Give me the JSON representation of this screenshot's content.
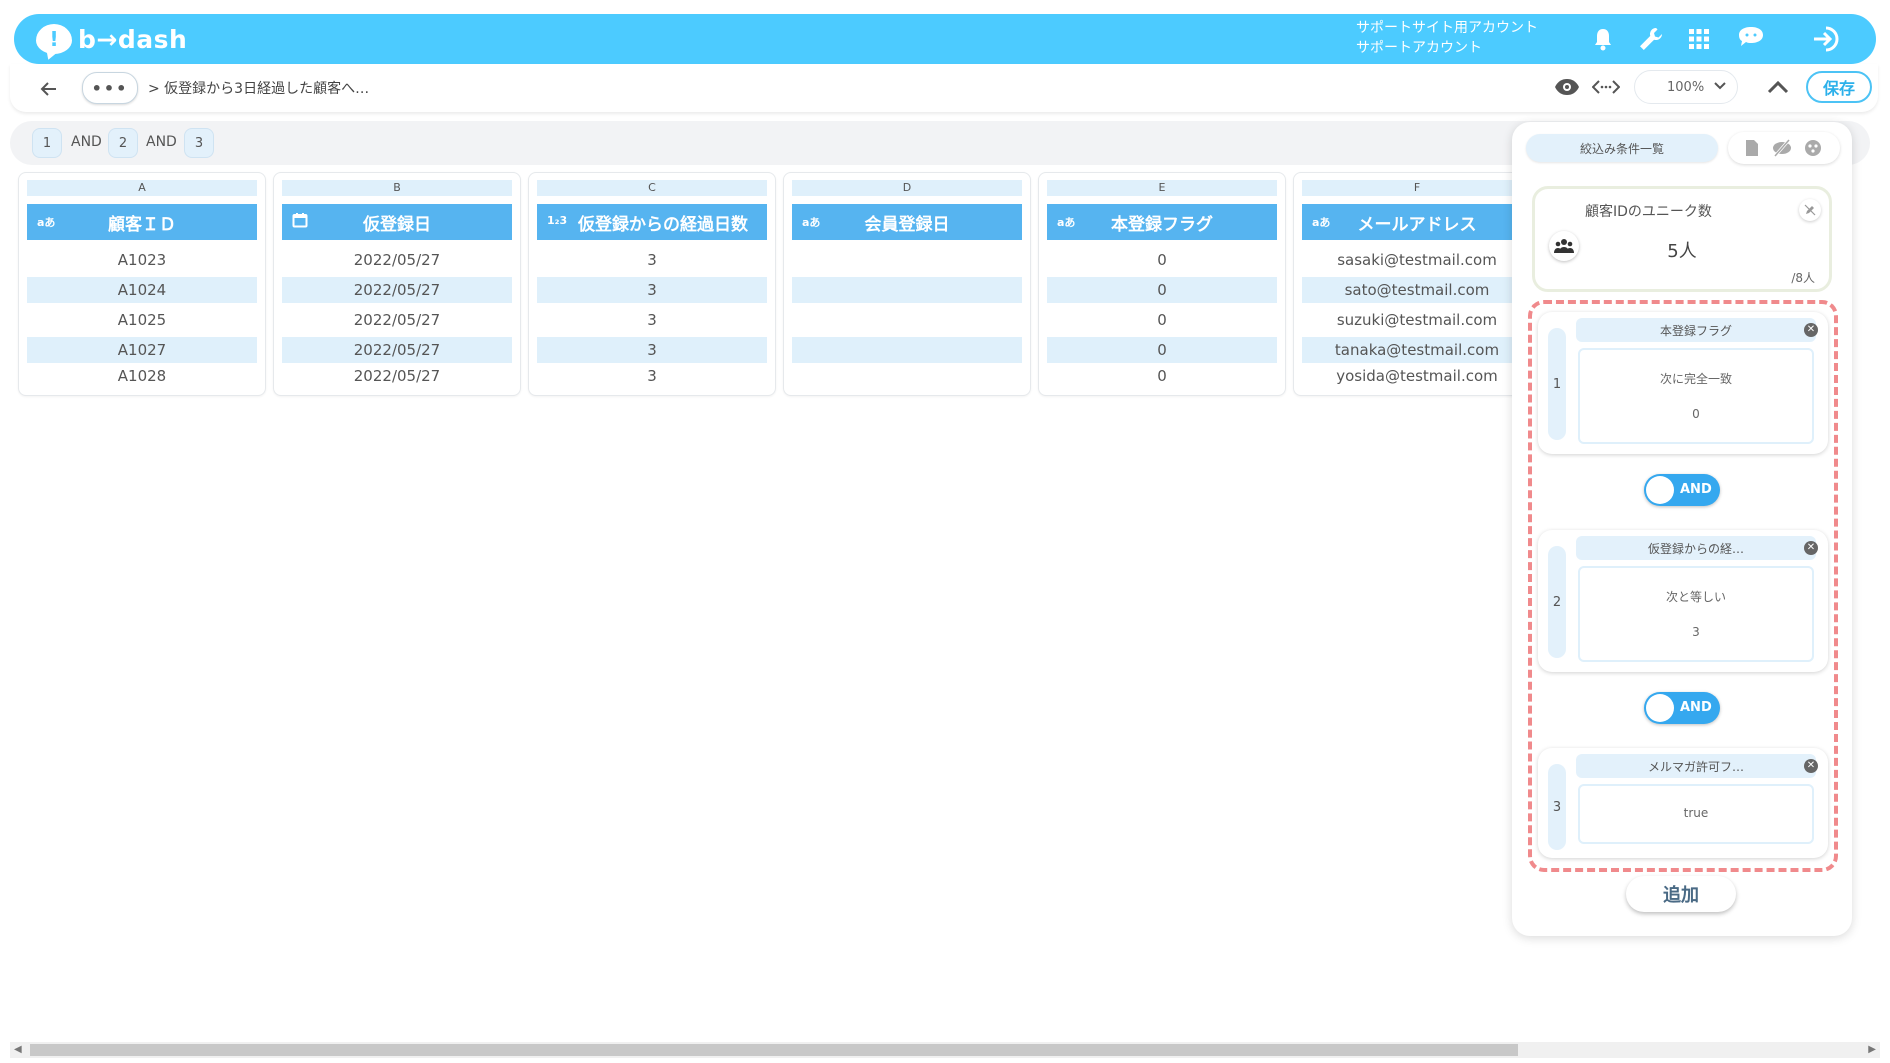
{
  "app": {
    "logo_text": "b→dash",
    "logo_mark": "!"
  },
  "header": {
    "account_line1": "サポートサイト用アカウント",
    "account_line2": "サポートアカウント"
  },
  "toolbar": {
    "more_label": "•••",
    "breadcrumb": "> 仮登録から3日経過した顧客へ…",
    "zoom": "100%",
    "save_label": "保存"
  },
  "filter_chips": {
    "chip1": "1",
    "and1": "AND",
    "chip2": "2",
    "and2": "AND",
    "chip3": "3"
  },
  "columns": [
    {
      "letter": "A",
      "type_badge": "aあ",
      "name": "顧客ＩＤ",
      "cells": [
        "A1023",
        "A1024",
        "A1025",
        "A1027",
        "A1028"
      ]
    },
    {
      "letter": "B",
      "type_badge": "",
      "name": "仮登録日",
      "cells": [
        "2022/05/27",
        "2022/05/27",
        "2022/05/27",
        "2022/05/27",
        "2022/05/27"
      ]
    },
    {
      "letter": "C",
      "type_badge": "1₂3",
      "name": "仮登録からの経過日数",
      "cells": [
        "3",
        "3",
        "3",
        "3",
        "3"
      ]
    },
    {
      "letter": "D",
      "type_badge": "aあ",
      "name": "会員登録日",
      "cells": [
        "",
        "",
        "",
        "",
        ""
      ]
    },
    {
      "letter": "E",
      "type_badge": "aあ",
      "name": "本登録フラグ",
      "cells": [
        "0",
        "0",
        "0",
        "0",
        "0"
      ]
    },
    {
      "letter": "F",
      "type_badge": "aあ",
      "name": "メールアドレス",
      "cells": [
        "sasaki@testmail.com",
        "sato@testmail.com",
        "suzuki@testmail.com",
        "tanaka@testmail.com",
        "yosida@testmail.com"
      ]
    }
  ],
  "panel": {
    "tab_label": "絞込み条件一覧",
    "unique": {
      "title": "顧客IDのユニーク数",
      "count": "5人",
      "total": "/8人"
    },
    "conditions": [
      {
        "num": "1",
        "title": "本登録フラグ",
        "operator": "次に完全一致",
        "value": "0"
      },
      {
        "num": "2",
        "title": "仮登録からの経…",
        "operator": "次と等しい",
        "value": "3"
      },
      {
        "num": "3",
        "title": "メルマガ許可フ…",
        "operator": "",
        "value": "true"
      }
    ],
    "and_label_1": "AND",
    "and_label_2": "AND",
    "add_label": "追加"
  },
  "colors": {
    "header": "#4ccbff",
    "column_header": "#56b4f0",
    "stripe": "#dff0fb",
    "dashed": "#f08a8c"
  }
}
